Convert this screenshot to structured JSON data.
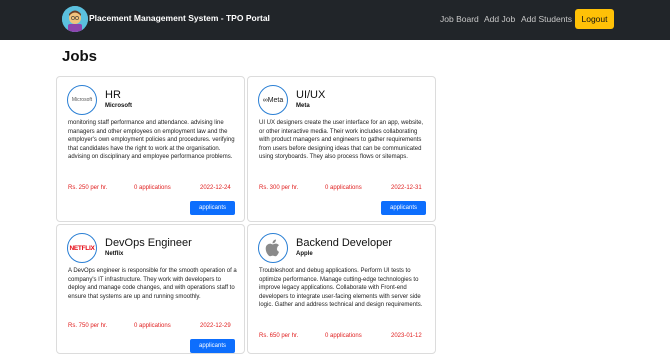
{
  "navbar": {
    "brand_title": "Placement Management System - TPO Portal",
    "links": [
      "Job Board",
      "Add Job",
      "Add Students"
    ],
    "logout_label": "Logout"
  },
  "page_title": "Jobs",
  "jobs": [
    {
      "title": "HR",
      "company": "Microsoft",
      "logo_text": "Microsoft",
      "description": "monitoring staff performance and attendance. advising line managers and other employees on employment law and the employer's own employment policies and procedures. verifying that candidates have the right to work at the organisation. advising on disciplinary and employee performance problems.",
      "salary": "Rs. 250 per hr.",
      "applications": "0 applications",
      "date": "2022-12-24",
      "button_label": "applicants"
    },
    {
      "title": "UI/UX",
      "company": "Meta",
      "logo_text": "∞Meta",
      "description": "UI UX designers create the user interface for an app, website, or other interactive media. Their work includes collaborating with product managers and engineers to gather requirements from users before designing ideas that can be communicated using storyboards. They also process flows or sitemaps.",
      "salary": "Rs. 300 per hr.",
      "applications": "0 applications",
      "date": "2022-12-31",
      "button_label": "applicants"
    },
    {
      "title": "DevOps Engineer",
      "company": "Netflix",
      "logo_text": "NETFLIX",
      "description": "A DevOps engineer is responsible for the smooth operation of a company's IT infrastructure. They work with developers to deploy and manage code changes, and with operations staff to ensure that systems are up and running smoothly.",
      "salary": "Rs. 750 per hr.",
      "applications": "0 applications",
      "date": "2022-12-29",
      "button_label": "applicants"
    },
    {
      "title": "Backend Developer",
      "company": "Apple",
      "logo_text": "",
      "description": "Troubleshoot and debug applications. Perform UI tests to optimize performance. Manage cutting-edge technologies to improve legacy applications. Collaborate with Front-end developers to integrate user-facing elements with server side logic. Gather and address technical and design requirements.",
      "salary": "Rs. 650 per hr.",
      "applications": "0 applications",
      "date": "2023-01-12",
      "button_label": "applicants"
    }
  ]
}
